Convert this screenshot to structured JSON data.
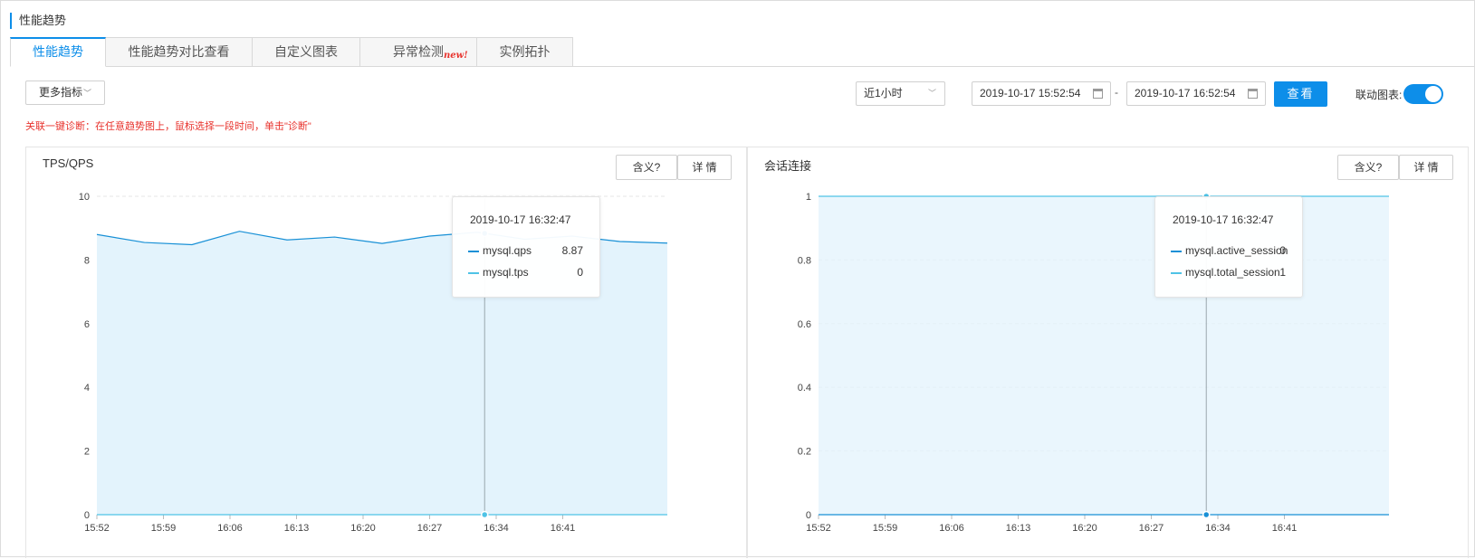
{
  "page": {
    "title": "性能趋势"
  },
  "tabs": [
    {
      "label": "性能趋势",
      "active": true
    },
    {
      "label": "性能趋势对比查看"
    },
    {
      "label": "自定义图表"
    },
    {
      "label": "异常检测",
      "badge": "new!"
    },
    {
      "label": "实例拓扑"
    }
  ],
  "toolbar": {
    "more_metrics": "更多指标",
    "time_range": "近1小时",
    "start_time": "2019-10-17 15:52:54",
    "dash": "-",
    "end_time": "2019-10-17 16:52:54",
    "query": "查看",
    "link_charts_label": "联动图表:",
    "link_charts_on": true
  },
  "hint": "关联一键诊断：在任意趋势图上，鼠标选择一段时间，单击\"诊断\"",
  "panel_buttons": {
    "meaning": "含义?",
    "detail": "详 情"
  },
  "colors": {
    "accent": "#0d8ee9",
    "qps": "#1890d6",
    "tps": "#4fc3e6",
    "area_fill": "#e3f3fc",
    "error": "#e8332d"
  },
  "chart_data": [
    {
      "type": "area",
      "title": "TPS/QPS",
      "x_ticks": [
        "15:52",
        "15:59",
        "16:06",
        "16:13",
        "16:20",
        "16:27",
        "16:34",
        "16:41"
      ],
      "x_range": [
        "15:52",
        "16:52"
      ],
      "ylim": [
        0,
        10
      ],
      "y_ticks": [
        0,
        2,
        4,
        6,
        8,
        10
      ],
      "grid": true,
      "series": [
        {
          "name": "mysql.qps",
          "color": "#1890d6",
          "x": [
            "15:52",
            "15:57",
            "16:02",
            "16:07",
            "16:12",
            "16:17",
            "16:22",
            "16:27",
            "16:32",
            "16:37",
            "16:42",
            "16:47",
            "16:52"
          ],
          "values": [
            8.8,
            8.55,
            8.48,
            8.9,
            8.63,
            8.72,
            8.52,
            8.75,
            8.87,
            8.65,
            8.75,
            8.58,
            8.53
          ]
        },
        {
          "name": "mysql.tps",
          "color": "#4fc3e6",
          "x": [
            "15:52",
            "16:52"
          ],
          "values": [
            0,
            0
          ]
        }
      ],
      "tooltip": {
        "time": "2019-10-17 16:32:47",
        "x": "16:32:47",
        "rows": [
          {
            "name": "mysql.qps",
            "value": "8.87"
          },
          {
            "name": "mysql.tps",
            "value": "0"
          }
        ]
      }
    },
    {
      "type": "area",
      "title": "会话连接",
      "x_ticks": [
        "15:52",
        "15:59",
        "16:06",
        "16:13",
        "16:20",
        "16:27",
        "16:34",
        "16:41"
      ],
      "x_range": [
        "15:52",
        "16:52"
      ],
      "ylim": [
        0,
        1
      ],
      "y_ticks": [
        0,
        0.2,
        0.4,
        0.6,
        0.8,
        1
      ],
      "grid": true,
      "series": [
        {
          "name": "mysql.active_session",
          "color": "#1890d6",
          "x": [
            "15:52",
            "16:52"
          ],
          "values": [
            0,
            0
          ]
        },
        {
          "name": "mysql.total_session",
          "color": "#4fc3e6",
          "x": [
            "15:52",
            "16:52"
          ],
          "values": [
            1,
            1
          ]
        }
      ],
      "tooltip": {
        "time": "2019-10-17 16:32:47",
        "x": "16:32:47",
        "rows": [
          {
            "name": "mysql.active_session",
            "value": "0"
          },
          {
            "name": "mysql.total_session",
            "value": "1"
          }
        ]
      }
    }
  ]
}
